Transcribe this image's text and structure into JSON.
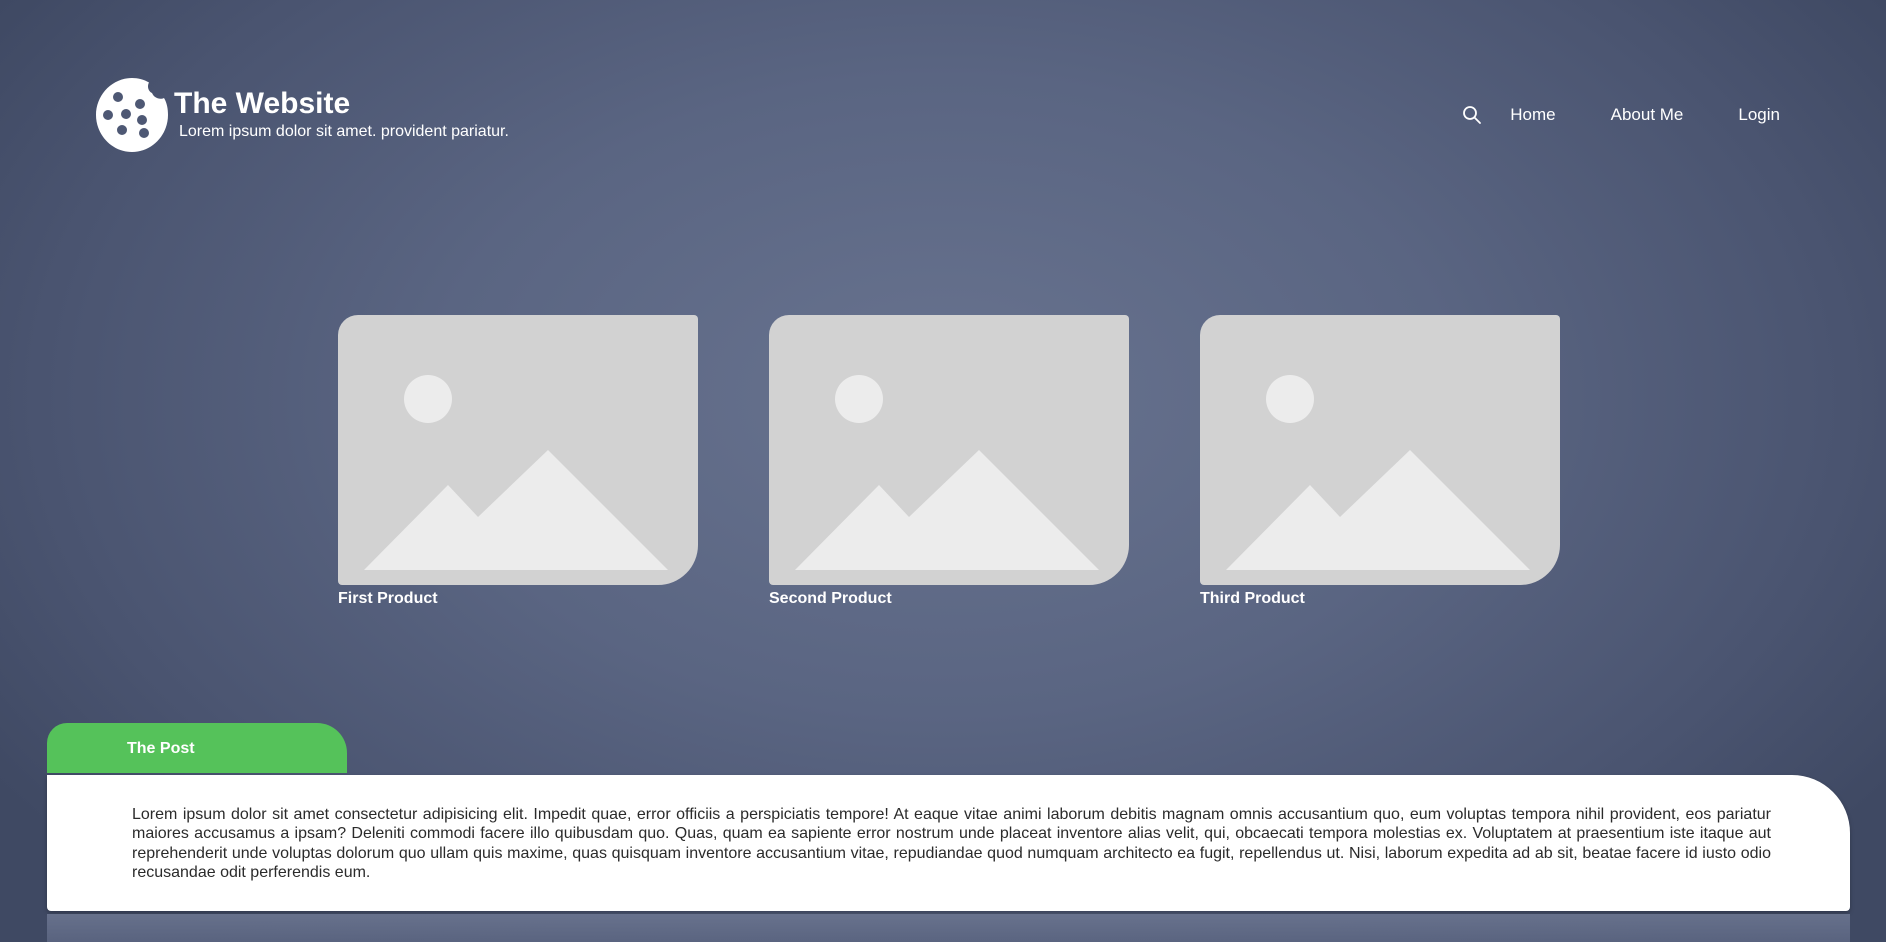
{
  "header": {
    "title": "The Website",
    "tagline": "Lorem ipsum dolor sit amet. provident pariatur.",
    "logo_icon": "cookie-icon"
  },
  "nav": {
    "search_icon": "search-icon",
    "items": [
      {
        "label": "Home"
      },
      {
        "label": "About Me"
      },
      {
        "label": "Login"
      }
    ]
  },
  "products": [
    {
      "name": "First Product",
      "image": "image-placeholder-icon"
    },
    {
      "name": "Second Product",
      "image": "image-placeholder-icon"
    },
    {
      "name": "Third Product",
      "image": "image-placeholder-icon"
    }
  ],
  "post": {
    "tab_label": "The Post",
    "body": "Lorem ipsum dolor sit amet consectetur adipisicing elit. Impedit quae, error officiis a perspiciatis tempore! At eaque vitae animi laborum debitis magnam omnis accusantium quo, eum voluptas tempora nihil provident, eos pariatur maiores accusamus a ipsam? Deleniti commodi facere illo quibusdam quo. Quas, quam ea sapiente error nostrum unde placeat inventore alias velit, qui, obcaecati tempora molestias ex. Voluptatem at praesentium iste itaque aut reprehenderit unde voluptas dolorum quo ullam quis maxime, quas quisquam inventore accusantium vitae, repudiandae quod numquam architecto ea fugit, repellendus ut. Nisi, laborum expedita ad ab sit, beatae facere id iusto odio recusandae odit perferendis eum."
  },
  "colors": {
    "background": "#5a6582",
    "accent": "#55c25a",
    "card": "#ffffff",
    "placeholder": "#d2d2d2"
  }
}
